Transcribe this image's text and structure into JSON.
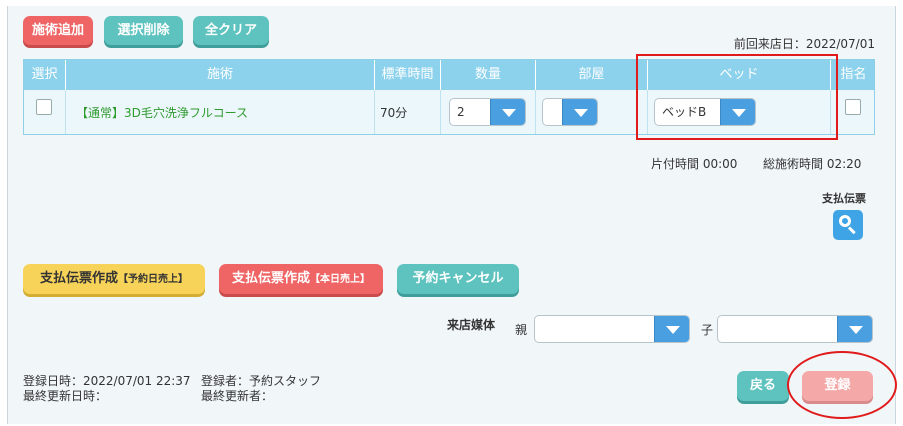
{
  "toolbar": {
    "add_label": "施術追加",
    "delete_label": "選択削除",
    "clear_label": "全クリア"
  },
  "last_visit": "前回来店日：2022/07/01",
  "table": {
    "headers": [
      "選択",
      "施術",
      "標準時間",
      "数量",
      "部屋",
      "ベッド",
      "指名"
    ],
    "row": {
      "treatment": "【通常】3D毛穴洗浄フルコース",
      "duration": "70分",
      "quantity": "2",
      "room": "",
      "bed": "ベッドB"
    }
  },
  "summary": {
    "cleanup": "片付時間 00:00",
    "total": "総施術時間 02:20"
  },
  "receipt": {
    "label": "支払伝票"
  },
  "actions": {
    "create_reserved_main": "支払伝票作成",
    "create_reserved_sub": "【予約日売上】",
    "create_today_main": "支払伝票作成",
    "create_today_sub": "【本日売上】",
    "cancel_label": "予約キャンセル"
  },
  "media": {
    "label": "来店媒体",
    "parent_label": "親",
    "child_label": "子",
    "parent_value": "",
    "child_value": ""
  },
  "meta": {
    "registered_at": "登録日時：2022/07/01 22:37",
    "updated_at": "最終更新日時：",
    "registered_by": "登録者：予約スタッフ",
    "updated_by": "最終更新者："
  },
  "footer": {
    "back_label": "戻る",
    "register_label": "登録"
  },
  "colors": {
    "accent_red": "#ef6464",
    "accent_teal": "#5ec3bf",
    "header_blue": "#8dd2ec",
    "select_blue": "#4a9fe0",
    "treatment_green": "#2e9a2e"
  }
}
